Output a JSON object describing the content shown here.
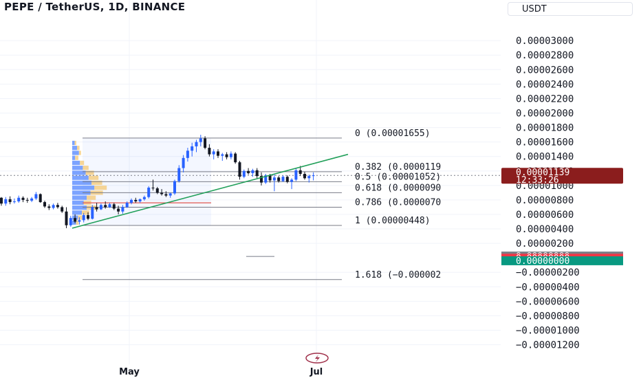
{
  "header": {
    "title": "PEPE / TetherUS, 1D, BINANCE",
    "currency": "USDT"
  },
  "colors": {
    "up": "#2962ff",
    "down": "#131722",
    "trendline": "#22a05a",
    "fib_line": "#787b86",
    "price_tag": "#8b1d1d",
    "tag_gray": "#7c7f87",
    "tag_red": "#f23645",
    "tag_teal": "#089981"
  },
  "chart_data": {
    "type": "candlestick",
    "x_labels": [
      "May",
      "Jul"
    ],
    "y_tick_labels": [
      "0.00003000",
      "0.00002800",
      "0.00002600",
      "0.00002400",
      "0.00002200",
      "0.00002000",
      "0.00001800",
      "0.00001600",
      "0.00001400",
      "0.00001200",
      "0.00001000",
      "0.00000800",
      "0.00000600",
      "0.00000400",
      "0.00000200",
      "−0.00000200",
      "−0.00000400",
      "−0.00000600",
      "−0.00000800",
      "−0.00001000",
      "−0.00001200"
    ],
    "y_ticks": [
      3e-05,
      2.8e-05,
      2.6e-05,
      2.4e-05,
      2.2e-05,
      2e-05,
      1.8e-05,
      1.6e-05,
      1.4e-05,
      1.2e-05,
      1e-05,
      8e-06,
      6e-06,
      4e-06,
      2e-06,
      -2e-06,
      -4e-06,
      -6e-06,
      -8e-06,
      -1e-05,
      -1.2e-05
    ],
    "ylim": [
      -1.28e-05,
      3.22e-05
    ],
    "fib_levels": [
      {
        "ratio": 0,
        "price": 1.655e-05,
        "label": "0 (0.00001655)"
      },
      {
        "ratio": 0.382,
        "price": 1.19e-05,
        "label": "0.382 (0.0000119"
      },
      {
        "ratio": 0.5,
        "price": 1.052e-05,
        "label": "0.5 (0.00001052)"
      },
      {
        "ratio": 0.618,
        "price": 9e-06,
        "label": "0.618 (0.0000090"
      },
      {
        "ratio": 0.786,
        "price": 7e-06,
        "label": "0.786 (0.0000070"
      },
      {
        "ratio": 1,
        "price": 4.48e-06,
        "label": "1 (0.00000448)"
      },
      {
        "ratio": 1.618,
        "price": -3e-06,
        "label": "1.618 (−0.000002"
      }
    ],
    "trendline": {
      "start": [
        0,
        4.1e-06
      ],
      "end": [
        80,
        1.43e-05
      ]
    },
    "last_price": {
      "value": "0.00001139",
      "countdown": "12:33:26",
      "price": 1.139e-05
    },
    "extra_tags": [
      {
        "label": "0.00000000",
        "price": 2e-07,
        "color": "tag_gray"
      },
      {
        "label": "0.00000000",
        "price": -1e-07,
        "color": "tag_red"
      },
      {
        "label": "0.00000000",
        "price": -4.5e-07,
        "color": "tag_teal"
      }
    ],
    "candles": [
      [
        8.3e-06,
        8.4e-06,
        7.2e-06,
        7.5e-06
      ],
      [
        7.5e-06,
        8.4e-06,
        7.2e-06,
        8.1e-06
      ],
      [
        8.1e-06,
        8.5e-06,
        7.4e-06,
        7.7e-06
      ],
      [
        7.7e-06,
        8.2e-06,
        7.5e-06,
        7.8e-06
      ],
      [
        7.8e-06,
        8.6e-06,
        7.6e-06,
        8.3e-06
      ],
      [
        8.3e-06,
        8.5e-06,
        7.7e-06,
        8e-06
      ],
      [
        8e-06,
        8.3e-06,
        7.6e-06,
        7.9e-06
      ],
      [
        7.9e-06,
        8.4e-06,
        7.7e-06,
        8.2e-06
      ],
      [
        8.2e-06,
        9.1e-06,
        8e-06,
        8.8e-06
      ],
      [
        8.8e-06,
        8.9e-06,
        7.6e-06,
        7.7e-06
      ],
      [
        7.7e-06,
        7.9e-06,
        6.9e-06,
        7.1e-06
      ],
      [
        7.1e-06,
        7.4e-06,
        6.6e-06,
        6.9e-06
      ],
      [
        6.9e-06,
        7.5e-06,
        6.7e-06,
        7.3e-06
      ],
      [
        7.3e-06,
        7.6e-06,
        6.8e-06,
        7e-06
      ],
      [
        7e-06,
        7.2e-06,
        6.2e-06,
        6.4e-06
      ],
      [
        6.4e-06,
        7e-06,
        4.1e-06,
        4.5e-06
      ],
      [
        4.5e-06,
        5.8e-06,
        4.3e-06,
        5.5e-06
      ],
      [
        5.5e-06,
        6e-06,
        4.8e-06,
        5e-06
      ],
      [
        5e-06,
        5.6e-06,
        4.6e-06,
        5.2e-06
      ],
      [
        5.2e-06,
        6.2e-06,
        4.9e-06,
        5.9e-06
      ],
      [
        5.9e-06,
        6.3e-06,
        5.2e-06,
        5.4e-06
      ],
      [
        5.4e-06,
        7.3e-06,
        5.3e-06,
        7e-06
      ],
      [
        7e-06,
        7.6e-06,
        6.4e-06,
        6.7e-06
      ],
      [
        6.7e-06,
        7.5e-06,
        6.6e-06,
        7.3e-06
      ],
      [
        7.3e-06,
        7.8e-06,
        6.8e-06,
        7e-06
      ],
      [
        7e-06,
        7.6e-06,
        6.9e-06,
        7.4e-06
      ],
      [
        7.4e-06,
        7.6e-06,
        6.6e-06,
        6.8e-06
      ],
      [
        6.8e-06,
        7.2e-06,
        6e-06,
        6.4e-06
      ],
      [
        6.4e-06,
        7.3e-06,
        6.1e-06,
        7e-06
      ],
      [
        7e-06,
        7.8e-06,
        6.9e-06,
        7.6e-06
      ],
      [
        7.6e-06,
        8.2e-06,
        7.4e-06,
        8e-06
      ],
      [
        8e-06,
        8.3e-06,
        7.6e-06,
        7.8e-06
      ],
      [
        7.8e-06,
        8.2e-06,
        7.6e-06,
        8.1e-06
      ],
      [
        8.1e-06,
        8.6e-06,
        7.9e-06,
        8.4e-06
      ],
      [
        8.4e-06,
        9.9e-06,
        8.2e-06,
        9.7e-06
      ],
      [
        9.7e-06,
        1.08e-05,
        9.3e-06,
        9.6e-06
      ],
      [
        9.6e-06,
        9.8e-06,
        8.8e-06,
        9e-06
      ],
      [
        9e-06,
        9.5e-06,
        8.6e-06,
        8.8e-06
      ],
      [
        8.8e-06,
        9.2e-06,
        8.4e-06,
        8.6e-06
      ],
      [
        8.6e-06,
        9e-06,
        8.3e-06,
        8.9e-06
      ],
      [
        8.9e-06,
        1.08e-05,
        8.7e-06,
        1.06e-05
      ],
      [
        1.06e-05,
        1.28e-05,
        1.04e-05,
        1.24e-05
      ],
      [
        1.24e-05,
        1.42e-05,
        1.18e-05,
        1.38e-05
      ],
      [
        1.38e-05,
        1.52e-05,
        1.33e-05,
        1.48e-05
      ],
      [
        1.48e-05,
        1.59e-05,
        1.4e-05,
        1.54e-05
      ],
      [
        1.54e-05,
        1.63e-05,
        1.46e-05,
        1.6e-05
      ],
      [
        1.6e-05,
        1.7e-05,
        1.54e-05,
        1.65e-05
      ],
      [
        1.65e-05,
        1.68e-05,
        1.5e-05,
        1.52e-05
      ],
      [
        1.52e-05,
        1.57e-05,
        1.4e-05,
        1.43e-05
      ],
      [
        1.43e-05,
        1.5e-05,
        1.36e-05,
        1.47e-05
      ],
      [
        1.47e-05,
        1.5e-05,
        1.38e-05,
        1.41e-05
      ],
      [
        1.41e-05,
        1.45e-05,
        1.34e-05,
        1.43e-05
      ],
      [
        1.43e-05,
        1.46e-05,
        1.36e-05,
        1.39e-05
      ],
      [
        1.39e-05,
        1.47e-05,
        1.36e-05,
        1.44e-05
      ],
      [
        1.44e-05,
        1.46e-05,
        1.3e-05,
        1.32e-05
      ],
      [
        1.32e-05,
        1.34e-05,
        1.08e-05,
        1.12e-05
      ],
      [
        1.12e-05,
        1.22e-05,
        1.1e-05,
        1.2e-05
      ],
      [
        1.2e-05,
        1.24e-05,
        1.15e-05,
        1.17e-05
      ],
      [
        1.17e-05,
        1.23e-05,
        1.12e-05,
        1.21e-05
      ],
      [
        1.21e-05,
        1.24e-05,
        1.1e-05,
        1.13e-05
      ],
      [
        1.13e-05,
        1.18e-05,
        1e-05,
        1.04e-05
      ],
      [
        1.04e-05,
        1.16e-05,
        1.02e-05,
        1.14e-05
      ],
      [
        1.14e-05,
        1.16e-05,
        1.04e-05,
        1.07e-05
      ],
      [
        1.07e-05,
        1.15e-05,
        9.2e-06,
        1.11e-05
      ],
      [
        1.11e-05,
        1.13e-05,
        1.04e-05,
        1.06e-05
      ],
      [
        1.06e-05,
        1.14e-05,
        1.05e-05,
        1.12e-05
      ],
      [
        1.12e-05,
        1.14e-05,
        1.03e-05,
        1.05e-05
      ],
      [
        1.05e-05,
        1.1e-05,
        9.5e-06,
        1.08e-05
      ],
      [
        1.08e-05,
        1.24e-05,
        1.06e-05,
        1.21e-05
      ],
      [
        1.21e-05,
        1.27e-05,
        1.13e-05,
        1.16e-05
      ],
      [
        1.16e-05,
        1.19e-05,
        1.08e-05,
        1.1e-05
      ],
      [
        1.1e-05,
        1.15e-05,
        1.04e-05,
        1.13e-05
      ],
      [
        1.13e-05,
        1.18e-05,
        1.07e-05,
        1.14e-05
      ]
    ]
  }
}
